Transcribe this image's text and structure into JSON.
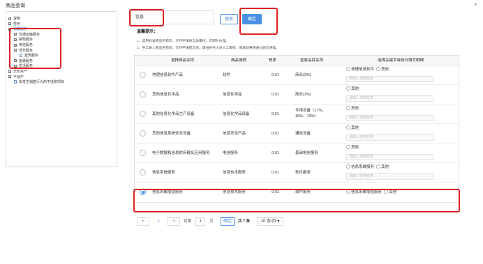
{
  "window": {
    "title": "商品查询",
    "close": "×"
  },
  "tree": [
    {
      "label": "货物",
      "level": 0,
      "exp": "+"
    },
    {
      "label": "劳务",
      "level": 0,
      "exp": "+"
    },
    {
      "label": "销售服务",
      "level": 0,
      "exp": "−",
      "selected": true
    },
    {
      "label": "交通运输服务",
      "level": 1,
      "exp": "+"
    },
    {
      "label": "邮政服务",
      "level": 1,
      "exp": "+"
    },
    {
      "label": "电信服务",
      "level": 1,
      "exp": "+"
    },
    {
      "label": "现代服务",
      "level": 1,
      "exp": "+"
    },
    {
      "label": "建筑服务",
      "level": 2,
      "doc": true
    },
    {
      "label": "金融服务",
      "level": 1,
      "exp": "+"
    },
    {
      "label": "生活服务",
      "level": 1,
      "exp": "+"
    },
    {
      "label": "无形资产",
      "level": 0,
      "exp": "+"
    },
    {
      "label": "不动产",
      "level": 0,
      "exp": "+"
    },
    {
      "label": "未发生销售行为的不征税项目",
      "level": 1,
      "doc": true
    }
  ],
  "search": {
    "value": "信息",
    "search_label": "搜索",
    "ok_label": "确定"
  },
  "notice": {
    "title": "温馨提示：",
    "line1": "1、选用标准商品名称的，代开申请将自动审核，可即时办理。",
    "line2": "2、手工录入商品名称的，代开申请提交后，需由税务人员人工审核，审核结果将通过短信通知。"
  },
  "table": {
    "headers": [
      "选择商品名称",
      "商品简称",
      "税率",
      "征收品目名称",
      "选择关键字或自行填写明细"
    ],
    "placeholder": "请输入货物名称",
    "rows": [
      {
        "name": "地理信息软件产品",
        "abbr": "软件",
        "rate": "0.01",
        "item": "商业(3%)",
        "options": [
          "地理信息软件",
          "其他"
        ],
        "checked": false
      },
      {
        "name": "其他信息化学品",
        "abbr": "信息化学品",
        "rate": "0.01",
        "item": "商业(3%)",
        "options": [
          "其他"
        ],
        "checked": false
      },
      {
        "name": "其他信息化学品生产设备",
        "abbr": "信息化学品设备",
        "rate": "0.01",
        "item": "专用设备（17%、16%、13%）",
        "options": [
          "其他"
        ],
        "checked": false
      },
      {
        "name": "其他信息系统安全设备",
        "abbr": "信息安全产品",
        "rate": "0.01",
        "item": "通信设备",
        "options": [
          "其他"
        ],
        "checked": false
      },
      {
        "name": "电子数据和信息的传输及应用服务",
        "abbr": "电信服务",
        "rate": "0.01",
        "item": "基础电信服务",
        "options": [
          "其他"
        ],
        "checked": false
      },
      {
        "name": "信息系统服务",
        "abbr": "信息技术服务",
        "rate": "0.01",
        "item": "软件服务",
        "options": [
          "信息系统服务",
          "其他"
        ],
        "checked": false
      },
      {
        "name": "信息系统增值服务",
        "abbr": "信息技术服务",
        "rate": "0.01",
        "item": "软件服务",
        "options": [
          "信息系统增值服务",
          "其他"
        ],
        "checked": true
      }
    ]
  },
  "pager": {
    "prev": "<",
    "page": "1",
    "next": ">",
    "goto_label": "到第",
    "goto_value": "1",
    "page_label": "页",
    "ok_label": "确定",
    "total": "共 7 条",
    "per_page": "10 条/页"
  },
  "colors": {
    "accent": "#4a90e2",
    "highlight": "#e02020"
  }
}
